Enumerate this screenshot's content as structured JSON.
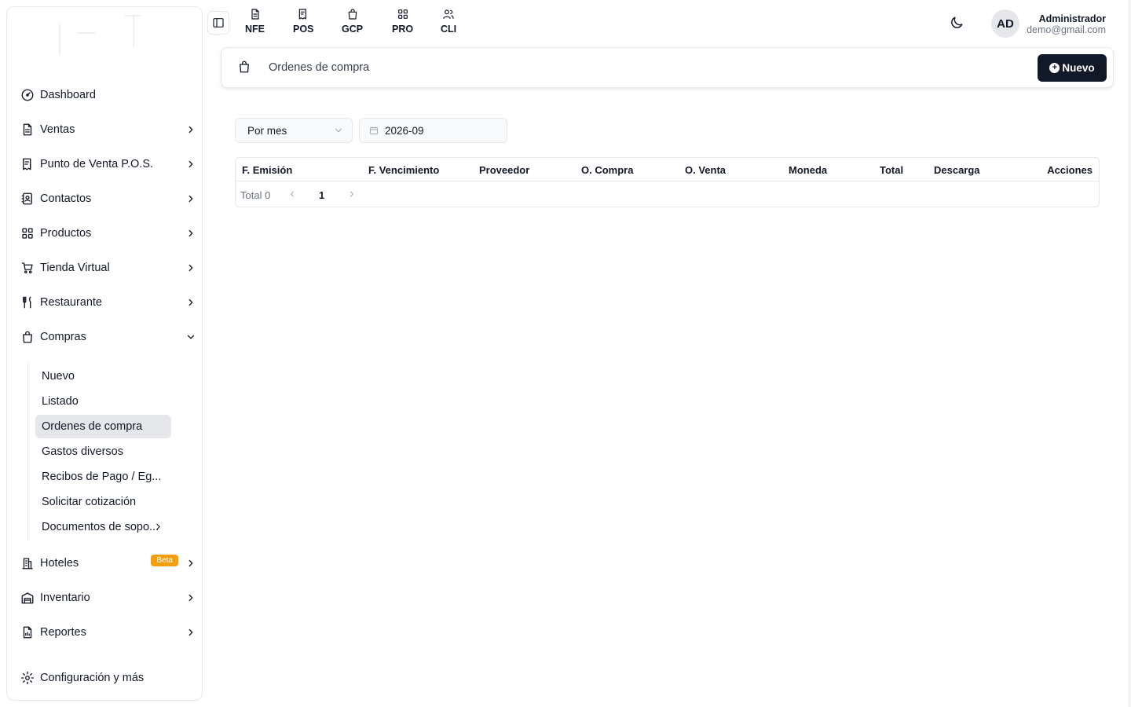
{
  "sidebar": {
    "items": [
      {
        "label": "Dashboard"
      },
      {
        "label": "Ventas"
      },
      {
        "label": "Punto de Venta P.O.S."
      },
      {
        "label": "Contactos"
      },
      {
        "label": "Productos"
      },
      {
        "label": "Tienda Virtual"
      },
      {
        "label": "Restaurante"
      },
      {
        "label": "Compras"
      },
      {
        "label": "Hoteles",
        "badge": "Beta"
      },
      {
        "label": "Inventario"
      },
      {
        "label": "Reportes"
      },
      {
        "label": "Configuración y más"
      }
    ],
    "compras_sub": [
      {
        "label": "Nuevo"
      },
      {
        "label": "Listado"
      },
      {
        "label": "Ordenes de compra",
        "active": true
      },
      {
        "label": "Gastos diversos"
      },
      {
        "label": "Recibos de Pago / Eg..."
      },
      {
        "label": "Solicitar cotización"
      },
      {
        "label": "Documentos de sopo..."
      }
    ]
  },
  "topbar": {
    "links": [
      {
        "label": "NFE",
        "icon": "file-text-icon"
      },
      {
        "label": "POS",
        "icon": "receipt-icon"
      },
      {
        "label": "GCP",
        "icon": "shopping-bag-icon"
      },
      {
        "label": "PRO",
        "icon": "grid-icon"
      },
      {
        "label": "CLI",
        "icon": "users-icon"
      }
    ],
    "user": {
      "initials": "AD",
      "name": "Administrador",
      "email": "demo@gmail.com"
    }
  },
  "header": {
    "title": "Ordenes de compra",
    "new_button": "Nuevo"
  },
  "filters": {
    "period": "Por mes",
    "date": "2026-09"
  },
  "table": {
    "columns": [
      "F. Emisión",
      "F. Vencimiento",
      "Proveedor",
      "O. Compra",
      "O. Venta",
      "Moneda",
      "Total",
      "Descarga",
      "Acciones"
    ],
    "rows": [],
    "total_label": "Total 0",
    "current_page": "1"
  },
  "colors": {
    "primary": "#111827",
    "badge": "#f59e0b",
    "active_bg": "#e5e7eb",
    "border": "#e5e7eb"
  }
}
